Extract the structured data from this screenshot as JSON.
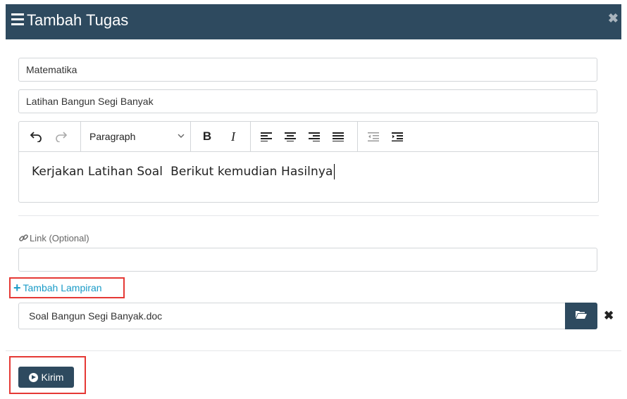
{
  "modal": {
    "title": "Tambah Tugas",
    "close_label": "✖"
  },
  "form": {
    "subject_value": "Matematika",
    "task_title_value": "Latihan Bangun Segi Banyak",
    "editor": {
      "undo_icon": "undo-icon",
      "redo_icon": "redo-icon",
      "paragraph_label": "Paragraph",
      "bold_label": "B",
      "italic_label": "I",
      "content": "Kerjakan Latihan Soal  Berikut kemudian Hasilnya"
    },
    "link_label": "Link (Optional)",
    "link_value": "",
    "add_attachment_label": "Tambah Lampiran",
    "attachment_file": "Soal Bangun Segi Banyak.doc",
    "remove_label": "✖",
    "submit_label": "Kirim"
  },
  "colors": {
    "header_bg": "#2e4a5f",
    "link_color": "#1a9bc7",
    "highlight": "#e53935"
  }
}
